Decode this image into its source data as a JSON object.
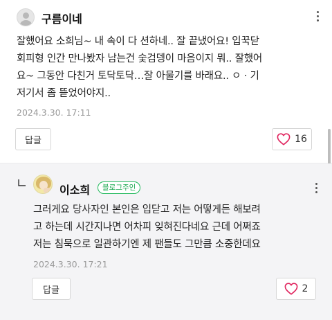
{
  "comments": [
    {
      "author": "구름이네",
      "lines": [
        "잘했어요 소희님~ 내 속이 다 션하네.. 잘 끝냈어요! 입꾹닫",
        "회피형 인간 만나봤자 남는건 숯검뎅이 마음이지 뭐.. 잘했어",
        "요~ 그동안 다친거 토닥토닥…잘 아물기를 바래요.. ㅇ · 기",
        "저기서 좀 뜯었어야지.."
      ],
      "date": "2024.3.30.  17:11",
      "reply_label": "답글",
      "like_count": "16"
    },
    {
      "author": "이소희",
      "badge": "블로그주인",
      "lines": [
        "그러게요 당사자인 본인은 입닫고 저는 어떻게든 해보려",
        "고 하는데 시간지나면 어차피 잊혀진다네요 근데 어쩌죠",
        "저는 침묵으로 일관하기엔 제 팬들도 그만큼 소중한데요"
      ],
      "date": "2024.3.30.  17:21",
      "reply_label": "답글",
      "like_count": "2"
    }
  ],
  "icons": {
    "heart": "heart-outline-icon",
    "more": "more-vertical-icon",
    "reply_arrow": "reply-arrow-icon"
  },
  "colors": {
    "heart": "#e0245e",
    "badge": "#1fb85a",
    "reply_bg": "#f4f4f6"
  }
}
